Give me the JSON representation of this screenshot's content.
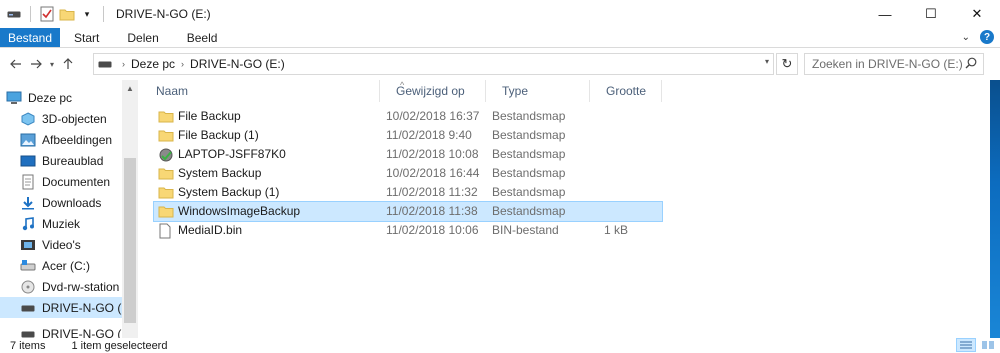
{
  "window": {
    "title": "DRIVE-N-GO (E:)",
    "minimize": "—",
    "maximize": "☐",
    "close": "✕"
  },
  "ribbon": {
    "tabs": [
      {
        "label": "Bestand",
        "active": true
      },
      {
        "label": "Start"
      },
      {
        "label": "Delen"
      },
      {
        "label": "Beeld"
      }
    ],
    "help": "?"
  },
  "nav": {
    "breadcrumbs": [
      "Deze pc",
      "DRIVE-N-GO (E:)"
    ],
    "search_placeholder": "Zoeken in DRIVE-N-GO (E:)"
  },
  "sidebar": {
    "items": [
      {
        "label": "Deze pc",
        "icon": "computer-icon"
      },
      {
        "label": "3D-objecten",
        "icon": "3d-objects-icon"
      },
      {
        "label": "Afbeeldingen",
        "icon": "pictures-icon"
      },
      {
        "label": "Bureaublad",
        "icon": "desktop-icon"
      },
      {
        "label": "Documenten",
        "icon": "documents-icon"
      },
      {
        "label": "Downloads",
        "icon": "downloads-icon"
      },
      {
        "label": "Muziek",
        "icon": "music-icon"
      },
      {
        "label": "Video's",
        "icon": "videos-icon"
      },
      {
        "label": "Acer (C:)",
        "icon": "drive-c-icon"
      },
      {
        "label": "Dvd-rw-station (",
        "icon": "dvd-drive-icon"
      },
      {
        "label": "DRIVE-N-GO (E:)",
        "icon": "usb-drive-icon",
        "selected": true
      },
      {
        "label": "DRIVE-N-GO (E:)",
        "icon": "usb-drive-icon"
      }
    ]
  },
  "columns": {
    "name": "Naam",
    "modified": "Gewijzigd op",
    "type": "Type",
    "size": "Grootte"
  },
  "files": [
    {
      "name": "File Backup",
      "date": "10/02/2018 16:37",
      "type": "Bestandsmap",
      "size": "",
      "icon": "folder-icon"
    },
    {
      "name": "File Backup (1)",
      "date": "11/02/2018 9:40",
      "type": "Bestandsmap",
      "size": "",
      "icon": "folder-icon"
    },
    {
      "name": "LAPTOP-JSFF87K0",
      "date": "11/02/2018 10:08",
      "type": "Bestandsmap",
      "size": "",
      "icon": "backup-folder-icon"
    },
    {
      "name": "System Backup",
      "date": "10/02/2018 16:44",
      "type": "Bestandsmap",
      "size": "",
      "icon": "folder-icon"
    },
    {
      "name": "System Backup (1)",
      "date": "11/02/2018 11:32",
      "type": "Bestandsmap",
      "size": "",
      "icon": "folder-icon"
    },
    {
      "name": "WindowsImageBackup",
      "date": "11/02/2018 11:38",
      "type": "Bestandsmap",
      "size": "",
      "icon": "folder-icon",
      "selected": true
    },
    {
      "name": "MediaID.bin",
      "date": "11/02/2018 10:06",
      "type": "BIN-bestand",
      "size": "1 kB",
      "icon": "file-icon"
    }
  ],
  "status": {
    "count": "7 items",
    "selection": "1 item geselecteerd"
  },
  "colors": {
    "accent": "#1979ca",
    "selection": "#cce8ff",
    "folder": "#f8d775"
  }
}
